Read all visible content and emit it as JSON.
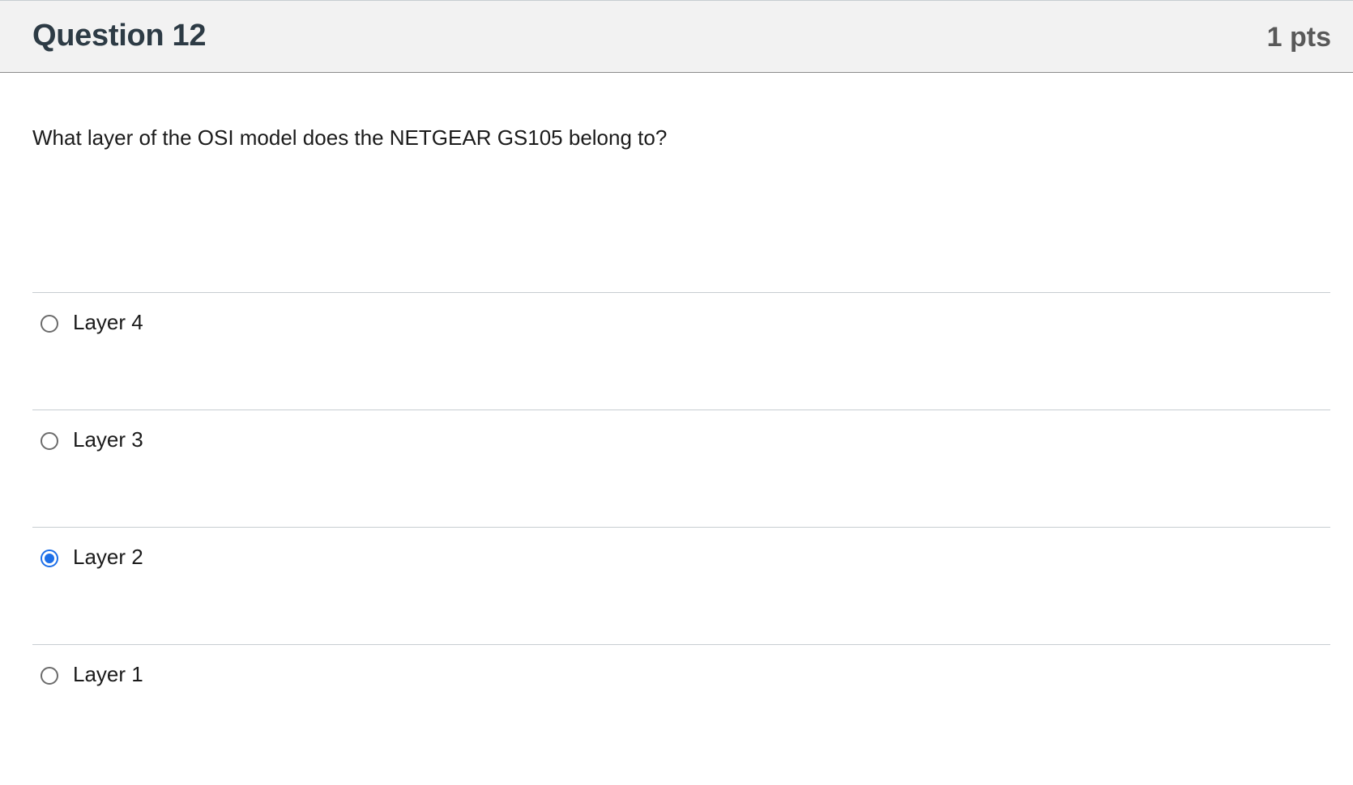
{
  "question": {
    "title": "Question 12",
    "points": "1 pts",
    "text": "What layer of the OSI model does the NETGEAR GS105 belong to?"
  },
  "answers": [
    {
      "label": "Layer 4",
      "selected": false
    },
    {
      "label": "Layer 3",
      "selected": false
    },
    {
      "label": "Layer 2",
      "selected": true
    },
    {
      "label": "Layer 1",
      "selected": false
    }
  ],
  "colors": {
    "accent": "#1d6fe8",
    "header_bg": "#f2f2f2",
    "title_text": "#2d3b45",
    "points_text": "#595959"
  },
  "icons": {
    "radio_unchecked": "radio-unchecked-icon",
    "radio_checked": "radio-checked-icon"
  }
}
